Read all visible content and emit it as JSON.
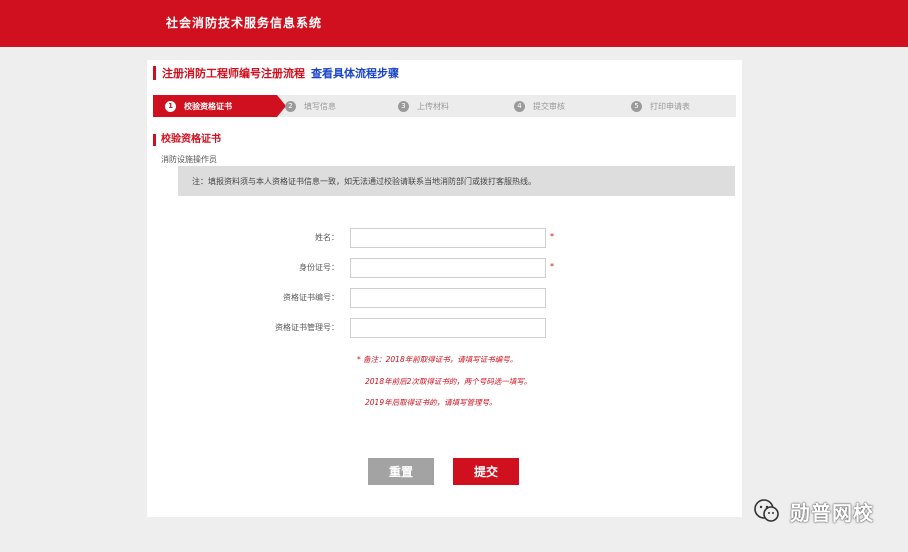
{
  "header": {
    "site_title": "社会消防技术服务信息系统"
  },
  "page": {
    "heading": "注册消防工程师编号注册流程",
    "heading_link": "查看具体流程步骤"
  },
  "steps": [
    {
      "num": "1",
      "label": "校验资格证书",
      "active": true
    },
    {
      "num": "2",
      "label": "填写信息"
    },
    {
      "num": "3",
      "label": "上传材料"
    },
    {
      "num": "4",
      "label": "提交审核"
    },
    {
      "num": "5",
      "label": "打印申请表"
    }
  ],
  "section": {
    "title": "校验资格证书",
    "subtitle": "消防设施操作员"
  },
  "notice": "注：填报资料须与本人资格证书信息一致，如无法通过校验请联系当地消防部门或拨打客服热线。",
  "form": {
    "fields": [
      {
        "label": "姓名：",
        "value": "",
        "required": true
      },
      {
        "label": "身份证号：",
        "value": "",
        "required": true
      },
      {
        "label": "资格证书编号：",
        "value": "",
        "required": false
      },
      {
        "label": "资格证书管理号：",
        "value": "",
        "required": false
      }
    ],
    "required_mark": "*"
  },
  "tips": [
    "* 备注：2018年前取得证书，请填写证书编号。",
    "2018年前后2次取得证书的，两个号码选一填写。",
    "2019年后取得证书的，请填写管理号。"
  ],
  "buttons": {
    "reset": "重置",
    "submit": "提交"
  },
  "watermark": {
    "text": "勋普网校"
  },
  "colors": {
    "brand_red": "#d0101e",
    "link_blue": "#1b45c9",
    "reset_gray": "#a3a3a3"
  }
}
